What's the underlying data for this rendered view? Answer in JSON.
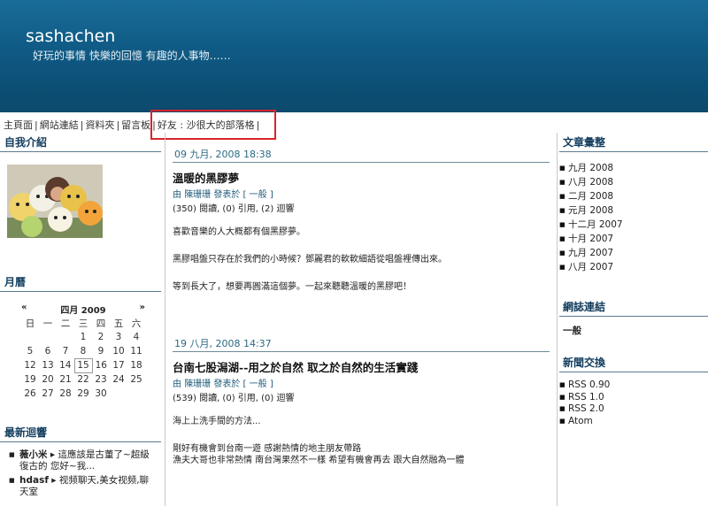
{
  "site": {
    "title": "sashachen",
    "subtitle": "好玩的事情 快樂的回憶 有趣的人事物……"
  },
  "nav": {
    "items": [
      {
        "label": "主頁面"
      },
      {
        "label": "網站連結"
      },
      {
        "label": "資料夾"
      },
      {
        "label": "留言板"
      },
      {
        "label": "好友 : 沙很大的部落格"
      }
    ]
  },
  "left": {
    "intro_title": "自我介紹",
    "calendar_title": "月曆",
    "calendar": {
      "prev": "«",
      "month": "四月 2009",
      "next": "»",
      "weekdays": [
        "日",
        "一",
        "二",
        "三",
        "四",
        "五",
        "六"
      ],
      "weeks": [
        [
          "",
          "",
          "",
          "1",
          "2",
          "3",
          "4"
        ],
        [
          "5",
          "6",
          "7",
          "8",
          "9",
          "10",
          "11"
        ],
        [
          "12",
          "13",
          "14",
          "15",
          "16",
          "17",
          "18"
        ],
        [
          "19",
          "20",
          "21",
          "22",
          "23",
          "24",
          "25"
        ],
        [
          "26",
          "27",
          "28",
          "29",
          "30",
          "",
          ""
        ]
      ],
      "today": "15"
    },
    "comments_title": "最新迴響",
    "comments": [
      {
        "author": "薇小米",
        "text": "這應該是古董了~超級復古的 您好~我..."
      },
      {
        "author": "hdasf",
        "text": "视频聊天,美女视频,聊天室"
      }
    ]
  },
  "posts": [
    {
      "date": "09 九月, 2008 18:38",
      "title": "溫暖的黑膠夢",
      "meta_prefix": "由",
      "author": "陳珊珊",
      "meta_mid": "發表於 [",
      "category": "一般",
      "meta_suffix": "]",
      "stats": "(350) 閱讀, (0) 引用, (2) 迴響",
      "paragraphs": [
        "喜歡音樂的人大概都有個黑膠夢。",
        "黑膠唱盤只存在於我們的小時候？鄧麗君的軟軟細語從唱盤裡傳出來。",
        "等到長大了，想要再圓滿這個夢。一起來聽聽溫暖的黑膠吧！"
      ]
    },
    {
      "date": "19 八月, 2008 14:37",
      "title": "台南七股潟湖--用之於自然 取之於自然的生活實踐",
      "meta_prefix": "由",
      "author": "陳珊珊",
      "meta_mid": "發表於 [",
      "category": "一般",
      "meta_suffix": "]",
      "stats": "(539) 閱讀, (0) 引用, (0) 迴響",
      "paragraphs": [
        "海上上洗手間的方法...",
        "剛好有機會到台南一遊 感謝熱情的地主朋友帶路\n漁夫大哥也非常熱情 南台灣果然不一樣 希望有機會再去 跟大自然融為一體"
      ]
    }
  ],
  "right": {
    "archive_title": "文章彙整",
    "archive": [
      "九月 2008",
      "八月 2008",
      "二月 2008",
      "元月 2008",
      "十二月 2007",
      "十月 2007",
      "九月 2007",
      "八月 2007"
    ],
    "links_title": "網誌連結",
    "links_category": "一般",
    "feeds_title": "新聞交換",
    "feeds": [
      "RSS 0.90",
      "RSS 1.0",
      "RSS 2.0",
      "Atom"
    ]
  },
  "colors": {
    "header_bg": "#0f5a84",
    "highlight_border": "#d8242a",
    "section_title": "#123d5e"
  }
}
